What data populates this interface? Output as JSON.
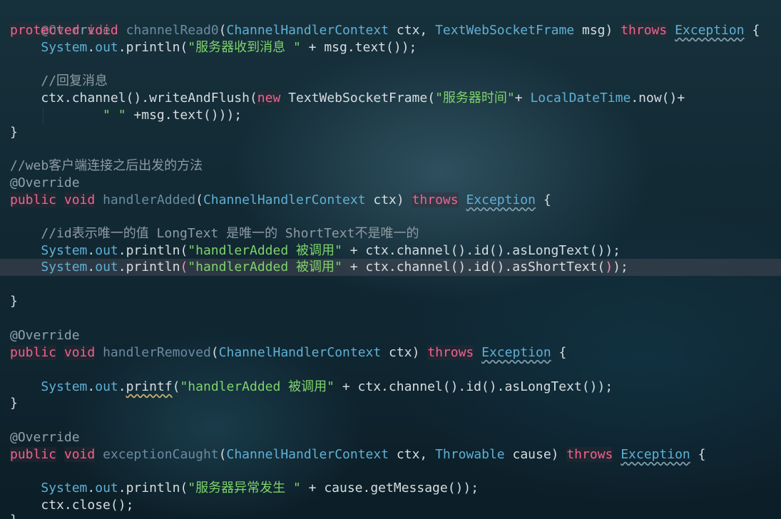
{
  "code": {
    "l1": {
      "ann": "@Override"
    },
    "l2": {
      "kw1": "protected",
      "kw2": "void",
      "fn": "channelRead0",
      "p1": "(",
      "t1": "ChannelHandlerContext",
      "a1": " ctx, ",
      "t2": "TextWebSocketFrame",
      "a2": " msg) ",
      "kw3": "throws",
      "sp": " ",
      "exc": "Exception",
      "end": " {"
    },
    "l3": {
      "obj": "System",
      "dot": ".",
      "field": "out",
      "call": ".println(",
      "str": "\"服务器收到消息 \"",
      "rest": " + msg.text());"
    },
    "l5": {
      "cmt": "//回复消息"
    },
    "l6": {
      "a": "ctx.channel().writeAndFlush(",
      "kw": "new",
      "b": " TextWebSocketFrame(",
      "str": "\"服务器时间\"",
      "c": "+ ",
      "cls": "LocalDateTime",
      "d": ".now()+"
    },
    "l7": {
      "str": "\" \"",
      "rest": " +msg.text()));"
    },
    "l8": {
      "brace": "}"
    },
    "l10": {
      "cmt": "//web客户端连接之后出发的方法"
    },
    "l11": {
      "ann": "@Override"
    },
    "l12": {
      "kw1": "public",
      "kw2": "void",
      "fn": "handlerAdded",
      "p1": "(",
      "t1": "ChannelHandlerContext",
      "a1": " ctx) ",
      "kw3": "throws",
      "exc": "Exception",
      "end": " {"
    },
    "l14": {
      "cmt": "//id表示唯一的值 LongText 是唯一的 ShortText不是唯一的"
    },
    "l15": {
      "obj": "System",
      "field": "out",
      "call": ".println(",
      "str": "\"handlerAdded 被调用\"",
      "rest": " + ctx.channel().id().asLongText());"
    },
    "l16": {
      "obj": "System",
      "field": "out",
      "call": ".println",
      "lp": "(",
      "str": "\"handlerAdded 被调用\"",
      "rest": " + ctx.channel().id().asShortText(",
      "rp": ")",
      "semi": ");"
    },
    "l18": {
      "brace": "}"
    },
    "l20": {
      "ann": "@Override"
    },
    "l21": {
      "kw1": "public",
      "kw2": "void",
      "fn": "handlerRemoved",
      "p1": "(",
      "t1": "ChannelHandlerContext",
      "a1": " ctx) ",
      "kw3": "throws",
      "exc": "Exception",
      "end": " {"
    },
    "l23": {
      "obj": "System",
      "field": "out",
      "dotp": ".",
      "call": "printf",
      "lp": "(",
      "str": "\"handlerAdded 被调用\"",
      "rest": " + ctx.channel().id().asLongText());"
    },
    "l24": {
      "brace": "}"
    },
    "l26": {
      "ann": "@Override"
    },
    "l27": {
      "kw1": "public",
      "kw2": "void",
      "fn": "exceptionCaught",
      "p1": "(",
      "t1": "ChannelHandlerContext",
      "a1": " ctx, ",
      "t2": "Throwable",
      "a2": " cause) ",
      "kw3": "throws",
      "exc": "Exception",
      "end": " {"
    },
    "l29": {
      "obj": "System",
      "field": "out",
      "call": ".println(",
      "str": "\"服务器异常发生 \"",
      "rest": " + cause.getMessage());"
    },
    "l30": {
      "text": "ctx.close();"
    },
    "l31": {
      "brace": "}"
    }
  },
  "colors": {
    "keyword": "#f06292",
    "type": "#5fb0d4",
    "string": "#7fd36b",
    "comment": "#8e9ba3",
    "method": "#6b8ba3"
  }
}
